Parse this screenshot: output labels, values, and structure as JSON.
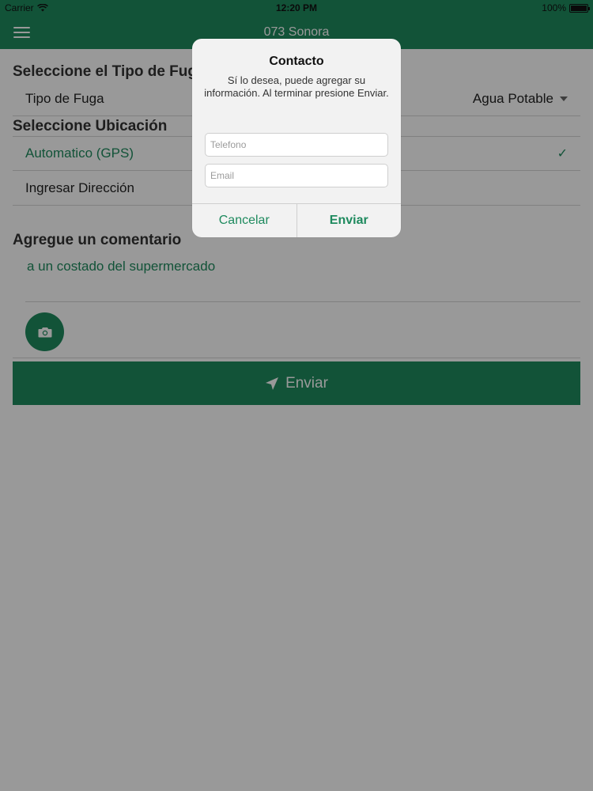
{
  "status_bar": {
    "carrier": "Carrier",
    "time": "12:20 PM",
    "battery": "100%"
  },
  "nav": {
    "title": "073 Sonora",
    "menu_icon": "hamburger-menu-icon"
  },
  "form": {
    "section_tipo": "Seleccione el Tipo de Fuga",
    "tipo_label": "Tipo de Fuga",
    "tipo_value": "Agua Potable",
    "section_ubicacion": "Seleccione Ubicación",
    "option_gps": "Automatico (GPS)",
    "option_direccion": "Ingresar Dirección",
    "section_comentario": "Agregue un comentario",
    "comment_value": "a un costado del supermercado",
    "send_label": "Enviar"
  },
  "dialog": {
    "title": "Contacto",
    "message": "Sí lo desea, puede agregar su información. Al terminar presione Enviar.",
    "telefono_placeholder": "Telefono",
    "email_placeholder": "Email",
    "cancel_label": "Cancelar",
    "send_label": "Enviar"
  },
  "colors": {
    "primary": "#1e8a5e",
    "overlay": "rgba(0,0,0,0.4)"
  }
}
